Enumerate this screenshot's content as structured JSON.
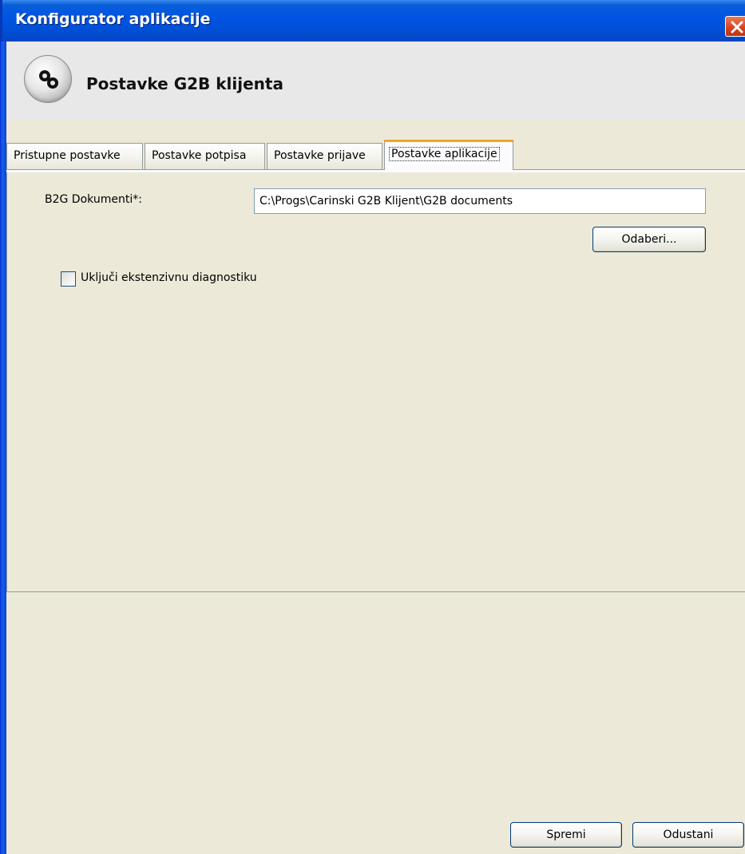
{
  "window": {
    "title": "Konfigurator aplikacije"
  },
  "header": {
    "title": "Postavke G2B klijenta",
    "icon": "gears-icon"
  },
  "tabs": [
    {
      "label": "Pristupne postavke",
      "active": false
    },
    {
      "label": "Postavke potpisa",
      "active": false
    },
    {
      "label": "Postavke prijave",
      "active": false
    },
    {
      "label": "Postavke aplikacije",
      "active": true
    }
  ],
  "form": {
    "documents_label": "B2G Dokumenti*:",
    "documents_path": "C:\\Progs\\Carinski G2B Klijent\\G2B documents",
    "browse_button": "Odaberi...",
    "diagnostics_label": "Uključi ekstenzivnu diagnostiku",
    "diagnostics_checked": false
  },
  "footer": {
    "save_button": "Spremi",
    "cancel_button": "Odustani"
  },
  "colors": {
    "titlebar": "#0054e3",
    "background": "#ece9d8",
    "close_button": "#d6421c",
    "active_tab_accent": "#f5a623"
  }
}
